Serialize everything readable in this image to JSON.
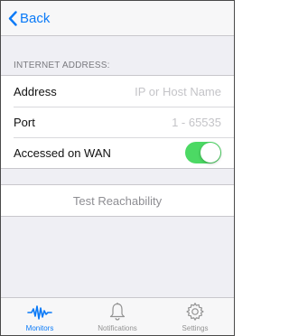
{
  "navbar": {
    "back_label": "Back"
  },
  "section": {
    "header": "INTERNET ADDRESS:"
  },
  "fields": {
    "address": {
      "label": "Address",
      "value": "",
      "placeholder": "IP or Host Name"
    },
    "port": {
      "label": "Port",
      "value": "",
      "placeholder": "1 - 65535"
    },
    "wan": {
      "label": "Accessed on WAN",
      "on": true
    }
  },
  "actions": {
    "test_label": "Test Reachability"
  },
  "tabbar": {
    "tabs": [
      {
        "label": "Monitors",
        "icon": "waveform-icon",
        "active": true
      },
      {
        "label": "Notifications",
        "icon": "bell-icon",
        "active": false
      },
      {
        "label": "Settings",
        "icon": "gear-icon",
        "active": false
      }
    ]
  },
  "colors": {
    "accent": "#0a7af7",
    "toggle_on": "#4cd964",
    "background": "#efeff4"
  }
}
